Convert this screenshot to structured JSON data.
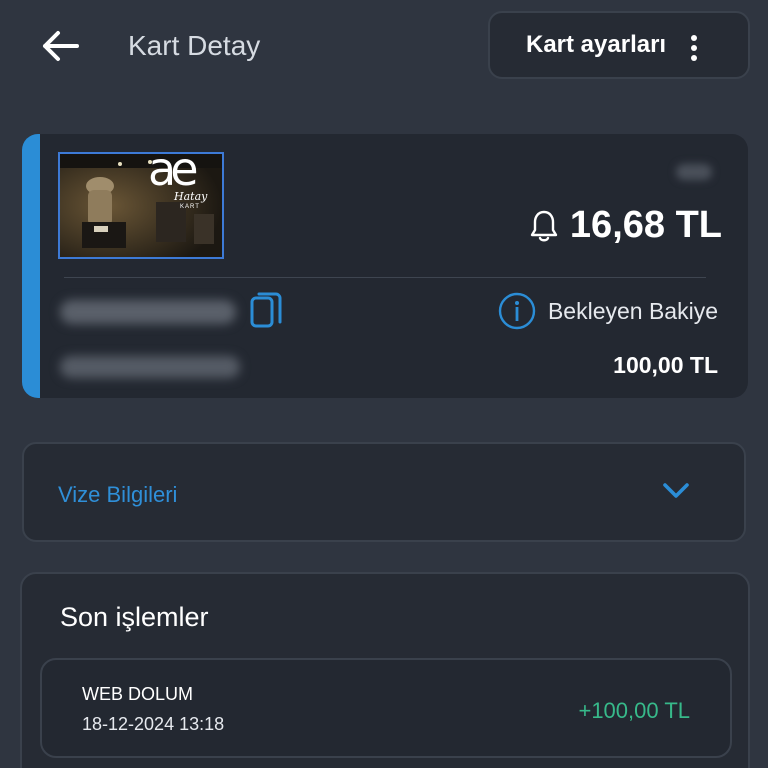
{
  "header": {
    "title": "Kart Detay",
    "settings_label": "Kart ayarları",
    "back_icon": "arrow-left-icon",
    "more_icon": "more-vertical-icon"
  },
  "card": {
    "image_text": "ae",
    "image_subtitle": "Hatay",
    "image_caption": "KART",
    "balance": "16,68 TL",
    "balance_icon": "bell-icon",
    "copy_icon": "copy-icon",
    "pending_icon": "info-icon",
    "pending_label": "Bekleyen Bakiye",
    "pending_value": "100,00 TL",
    "accent_color": "#2b8dd6"
  },
  "visa": {
    "label": "Vize Bilgileri",
    "chevron_icon": "chevron-down-icon"
  },
  "transactions": {
    "title": "Son işlemler",
    "items": [
      {
        "type": "WEB DOLUM",
        "date": "18-12-2024 13:18",
        "amount": "+100,00 TL"
      }
    ]
  },
  "colors": {
    "background": "#2f3540",
    "accent": "#2b8dd6",
    "positive": "#37b98a"
  }
}
